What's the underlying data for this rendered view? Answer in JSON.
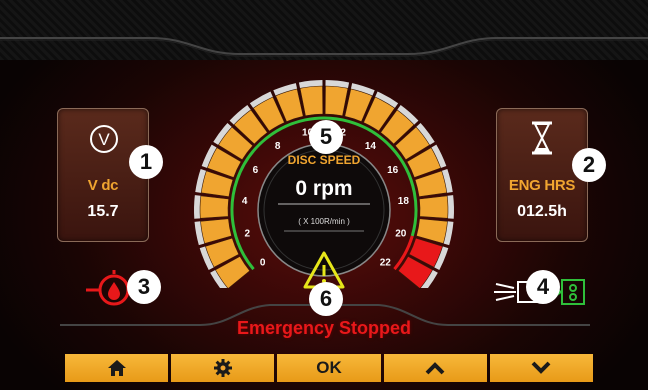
{
  "panels": {
    "voltage": {
      "icon": "V",
      "label": "V dc",
      "value": "15.7",
      "badge": "1"
    },
    "engine_hours": {
      "label": "ENG HRS",
      "value": "012.5h",
      "badge": "2"
    }
  },
  "gauge": {
    "label": "DISC SPEED",
    "value": "0 rpm",
    "unit_note": "( X 100R/min )",
    "ticks": [
      "0",
      "2",
      "4",
      "6",
      "8",
      "10",
      "12",
      "14",
      "16",
      "18",
      "20",
      "22"
    ],
    "badge": "5",
    "rpm_value": 0,
    "range": [
      0,
      22
    ],
    "redline_start": 20
  },
  "indicators": {
    "oil": {
      "badge": "3"
    },
    "warning": {
      "badge": "6"
    },
    "glow": {
      "badge": "4"
    }
  },
  "status_text": "Emergency Stopped",
  "toolbar": {
    "ok_label": "OK"
  },
  "colors": {
    "accent": "#f0a530",
    "alarm": "#e8181a",
    "ok_green": "#2fbf3a",
    "warning": "#e6e61a"
  }
}
